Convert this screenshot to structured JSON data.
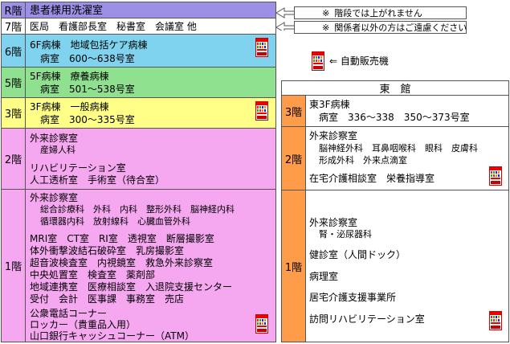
{
  "main": {
    "floors": [
      {
        "key": "R",
        "label": "R階",
        "color": "#9b8fe6",
        "lines": [
          "患者様用洗濯室"
        ]
      },
      {
        "key": "7",
        "label": "7階",
        "color": "#ffffff",
        "lines": [
          "医局　看護部長室　秘書室　会議室 他"
        ]
      },
      {
        "key": "6",
        "label": "6階",
        "color": "#7fd3ee",
        "lines": [
          "6F病棟　地域包括ケア病棟",
          "病室　600〜638号室"
        ]
      },
      {
        "key": "5",
        "label": "5階",
        "color": "#8fe08f",
        "lines": [
          "5F病棟　療養病棟",
          "病室　501〜538号室"
        ]
      },
      {
        "key": "3",
        "label": "3階",
        "color": "#ffff88",
        "lines": [
          "3F病棟　一般病棟",
          "病室　300〜335号室"
        ]
      },
      {
        "key": "2",
        "label": "2階",
        "color": "#f5a8f0",
        "lines": [
          "外来診察室",
          "産婦人科",
          "リハビリテーション室",
          "人工透析室　手術室（待合室）"
        ]
      },
      {
        "key": "1",
        "label": "1階",
        "color": "#f5a8f0",
        "lines": [
          "外来診察室",
          "総合診療科　外科　内科　整形外科　脳神経内科",
          "循環器内科　放射線科　心臓血管外科",
          "MRI室　CT室　RI室　透視室　断層撮影室",
          "体外衝撃波結石破砕室　乳房撮影室",
          "超音波検査室　内視鏡室　救急外来診察室",
          "中央処置室　検査室　薬剤部",
          "地域連携室　医療相談室　入退院支援センター",
          "受付　会計　医事課　事務室　売店",
          "公衆電話コーナー",
          "ロッカー（貴重品入用）",
          "山口銀行キャッシュコーナー（ATM）"
        ]
      }
    ]
  },
  "east": {
    "title": "東　館",
    "color": "#ff9c4a",
    "floors": [
      {
        "key": "3",
        "label": "3階",
        "lines": [
          "東3F病棟",
          "病室　336〜338　350〜373号室"
        ]
      },
      {
        "key": "2",
        "label": "2階",
        "lines": [
          "外来診察室",
          "脳神経外科　耳鼻咽喉科　眼科　皮膚科",
          "形成外科　外来点滴室",
          "在宅介護相談室　栄養指導室"
        ]
      },
      {
        "key": "1",
        "label": "1階",
        "lines": [
          "外来診察室",
          "腎・泌尿器科",
          "健診室（人間ドック）",
          "病理室",
          "居宅介護支援事業所",
          "訪問リハビリテーション室"
        ]
      }
    ]
  },
  "notes": [
    {
      "symbol": "※",
      "text": "階段では上がれません"
    },
    {
      "symbol": "※",
      "text": "関係者以外の方はご遠慮ください"
    }
  ],
  "legend": {
    "text": "⇐ 自動販売機",
    "icon": "vending-machine-icon"
  }
}
